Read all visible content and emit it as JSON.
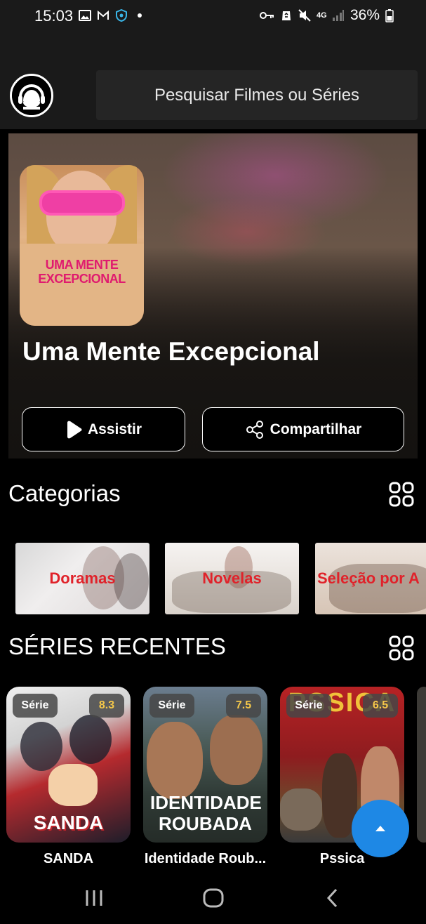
{
  "status_bar": {
    "time": "15:03",
    "battery": "36%",
    "network": "4G",
    "icons": [
      "image-icon",
      "gmail-icon",
      "shield-icon",
      "dot-icon",
      "key-icon",
      "recycle-icon",
      "mute-icon",
      "signal-icon",
      "battery-icon"
    ]
  },
  "header": {
    "logo_icon": "headset-user-icon",
    "search_placeholder": "Pesquisar Filmes ou Séries"
  },
  "hero": {
    "poster_title": "UMA MENTE EXCEPCIONAL",
    "title": "Uma Mente Excepcional",
    "watch_label": "Assistir",
    "share_label": "Compartilhar"
  },
  "categories": {
    "title": "Categorias",
    "items": [
      {
        "label": "Doramas"
      },
      {
        "label": "Novelas"
      },
      {
        "label": "Seleção por A"
      }
    ]
  },
  "recent_series": {
    "title": "SÉRIES RECENTES",
    "items": [
      {
        "type": "Série",
        "rating": "8.3",
        "name": "SANDA",
        "poster_text": "SANDA"
      },
      {
        "type": "Série",
        "rating": "7.5",
        "name": "Identidade Roub...",
        "poster_text": "IDENTIDADE ROUBADA"
      },
      {
        "type": "Série",
        "rating": "6.5",
        "name": "Pssica",
        "poster_text": "PSSICA"
      }
    ]
  },
  "colors": {
    "accent_blue": "#1e88e5",
    "category_text": "#e0222a",
    "rating": "#f5c84a"
  }
}
